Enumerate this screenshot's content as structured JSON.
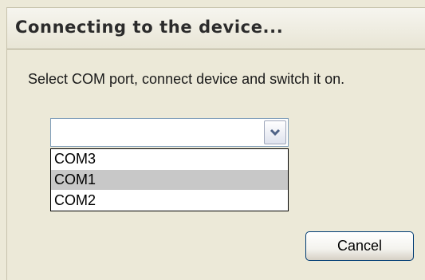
{
  "dialog": {
    "title": "Connecting to the device...",
    "instruction": "Select COM port, connect device and switch it on.",
    "combo": {
      "value": "",
      "icon": "chevron-down-icon",
      "options": [
        "COM3",
        "COM1",
        "COM2"
      ],
      "highlighted_option": "COM1"
    },
    "cancel_label": "Cancel"
  }
}
